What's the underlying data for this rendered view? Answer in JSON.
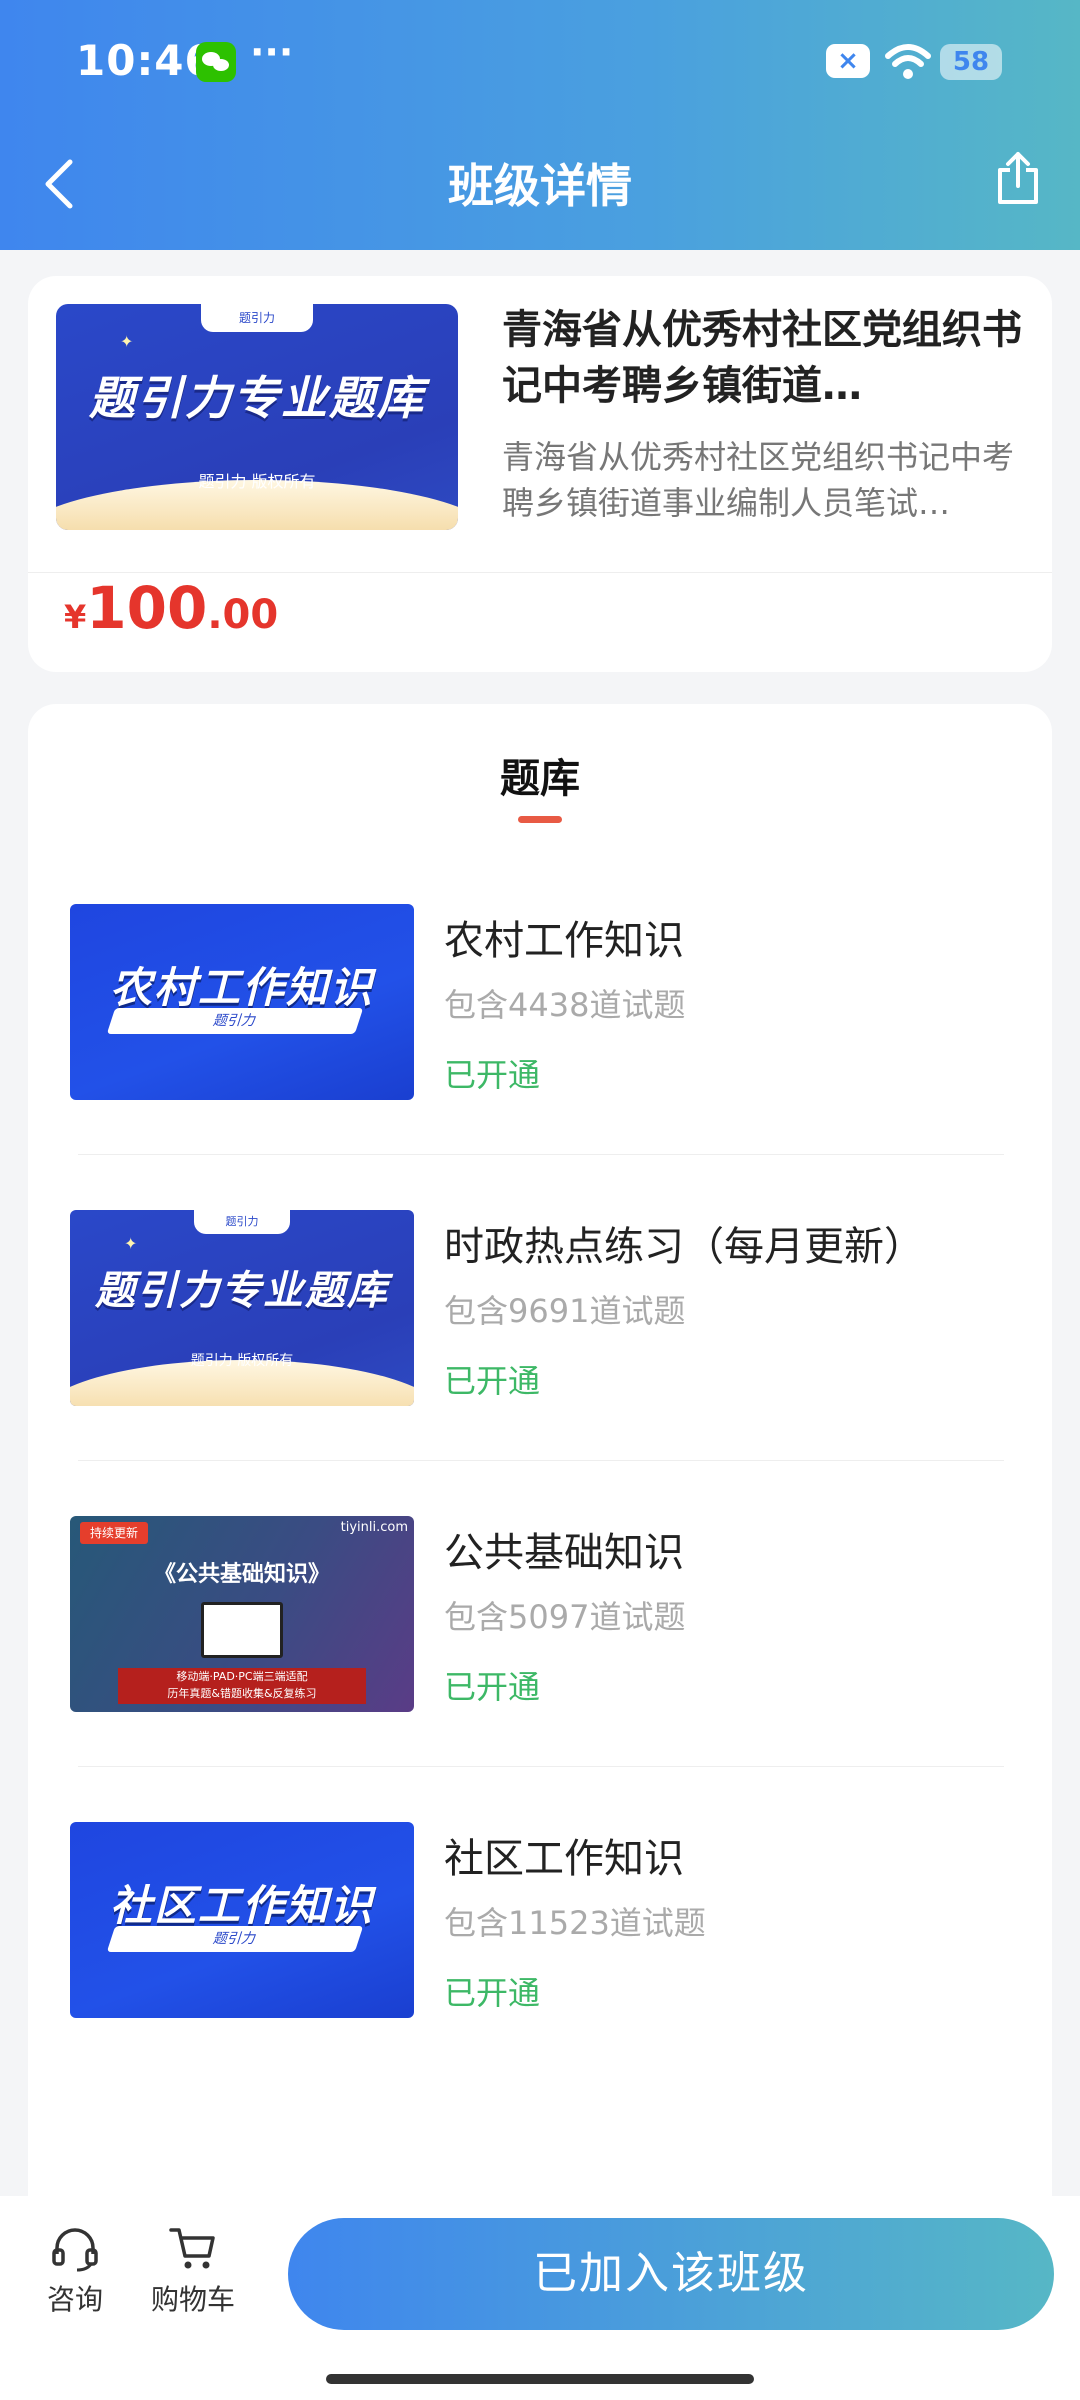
{
  "status_bar": {
    "time": "10:46",
    "dots": "···",
    "x_badge": "×",
    "battery": "58",
    "battery_level": 0.58
  },
  "header": {
    "title": "班级详情"
  },
  "course": {
    "cover": {
      "tab": "题引力",
      "title": "题引力专业题库",
      "sub": "题引力 版权所有"
    },
    "title": "青海省从优秀村社区党组织书记中考聘乡镇街道…",
    "desc": "青海省从优秀村社区党组织书记中考聘乡镇街道事业编制人员笔试…",
    "price": {
      "currency": "¥",
      "integer": "100",
      "decimal": ".00"
    }
  },
  "section": {
    "title": "题库"
  },
  "banks": [
    {
      "cover_title": "农村工作知识",
      "cover_sub": "题引力",
      "name": "农村工作知识",
      "count": "包含4438道试题",
      "status": "已开通"
    },
    {
      "cover_tab": "题引力",
      "cover_title": "题引力专业题库",
      "cover_sub": "题引力 版权所有",
      "name": "时政热点练习（每月更新）",
      "count": "包含9691道试题",
      "status": "已开通"
    },
    {
      "cover_tag": "持续更新",
      "cover_logo": "tiyinli.com",
      "cover_title": "《公共基础知识》",
      "cover_banner": "移动端·PAD·PC端三端适配\n历年真题&错题收集&反复练习",
      "name": "公共基础知识",
      "count": "包含5097道试题",
      "status": "已开通"
    },
    {
      "cover_title": "社区工作知识",
      "cover_sub": "题引力",
      "name": "社区工作知识",
      "count": "包含11523道试题",
      "status": "已开通"
    }
  ],
  "bottom": {
    "consult": "咨询",
    "cart": "购物车",
    "join": "已加入该班级"
  },
  "colors": {
    "accent": "#3f86ee",
    "price": "#e5352c",
    "status_green": "#3db866"
  }
}
